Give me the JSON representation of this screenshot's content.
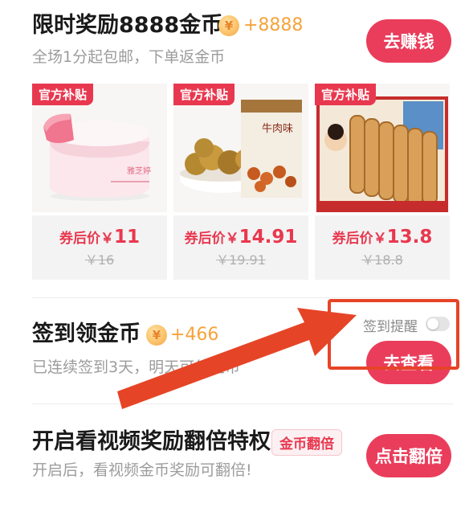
{
  "task1": {
    "title": "限时奖励8888金币",
    "reward": "+8888",
    "subtitle": "全场1分起包邮，下单返金币",
    "button": "去赚钱"
  },
  "products": [
    {
      "tag": "官方补贴",
      "price_label": "券后价￥",
      "price": "11",
      "original": "￥16",
      "image": "face-cream-jar"
    },
    {
      "tag": "官方补贴",
      "price_label": "券后价￥",
      "price": "14.91",
      "original": "￥19.91",
      "image": "snack-nuts-bag"
    },
    {
      "tag": "官方补贴",
      "price_label": "券后价￥",
      "price": "13.8",
      "original": "￥18.8",
      "image": "egg-roll-biscuits"
    }
  ],
  "task2": {
    "title": "签到领金币",
    "reward": "+466",
    "subtitle": "已连续签到3天，明天可领金币",
    "button": "去查看",
    "remind_label": "签到提醒",
    "remind_on": false
  },
  "task3": {
    "title": "开启看视频奖励翻倍特权",
    "badge": "金币翻倍",
    "subtitle": "开启后，看视频金币奖励可翻倍!",
    "button": "点击翻倍"
  },
  "colors": {
    "accent": "#ea3d5c",
    "coin": "#f6a33b",
    "annotation": "#e64427"
  },
  "icons": {
    "coin": "coin-yen-icon"
  }
}
